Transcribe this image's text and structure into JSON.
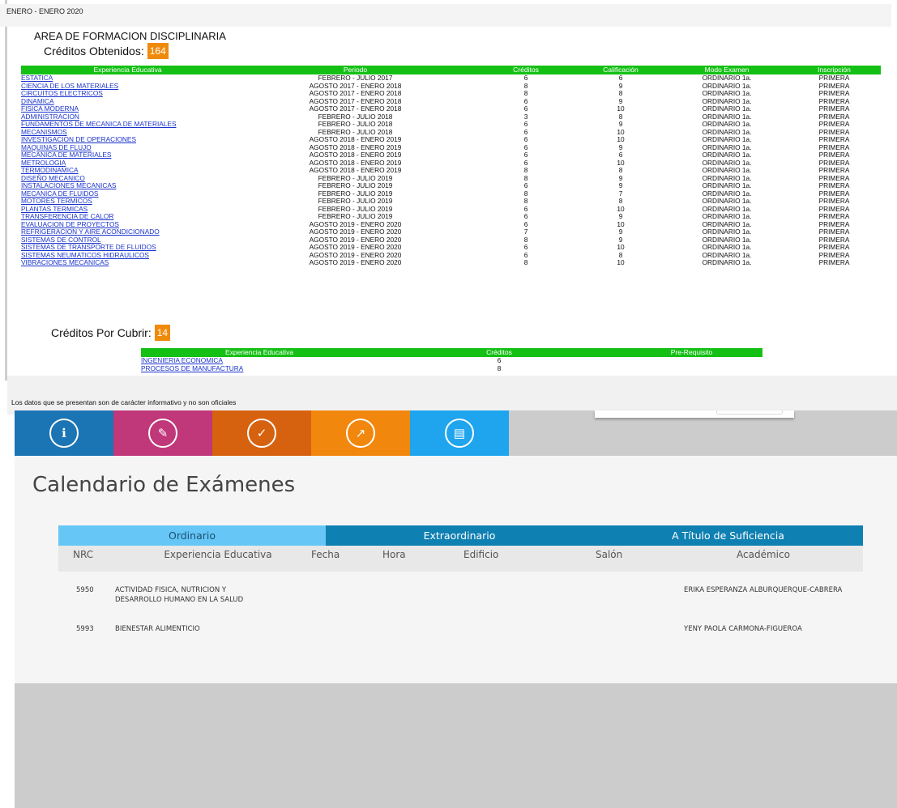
{
  "period_header": "ENERO - ENERO 2020",
  "area_title": "AREA DE FORMACION DISCIPLINARIA",
  "credits_obtained": {
    "label": "Créditos Obtenidos:",
    "value": "164"
  },
  "credits_pending": {
    "label": "Créditos Por Cubrir:",
    "value": "14"
  },
  "records_table": {
    "headers": [
      "Experiencia Educativa",
      "Periodo",
      "Créditos",
      "Calificación",
      "Modo Examen",
      "Inscripción"
    ],
    "rows": [
      [
        "ESTATICA",
        "FEBRERO - JULIO 2017",
        "6",
        "6",
        "ORDINARIO 1a.",
        "PRIMERA"
      ],
      [
        "CIENCIA DE LOS MATERIALES",
        "AGOSTO 2017 - ENERO 2018",
        "8",
        "9",
        "ORDINARIO 1a.",
        "PRIMERA"
      ],
      [
        "CIRCUITOS ELECTRICOS",
        "AGOSTO 2017 - ENERO 2018",
        "8",
        "8",
        "ORDINARIO 1a.",
        "PRIMERA"
      ],
      [
        "DINAMICA",
        "AGOSTO 2017 - ENERO 2018",
        "6",
        "9",
        "ORDINARIO 1a.",
        "PRIMERA"
      ],
      [
        "FISICA MODERNA",
        "AGOSTO 2017 - ENERO 2018",
        "6",
        "10",
        "ORDINARIO 1a.",
        "PRIMERA"
      ],
      [
        "ADMINISTRACION",
        "FEBRERO - JULIO 2018",
        "3",
        "8",
        "ORDINARIO 1a.",
        "PRIMERA"
      ],
      [
        "FUNDAMENTOS DE MECANICA DE MATERIALES",
        "FEBRERO - JULIO 2018",
        "6",
        "9",
        "ORDINARIO 1a.",
        "PRIMERA"
      ],
      [
        "MECANISMOS",
        "FEBRERO - JULIO 2018",
        "6",
        "10",
        "ORDINARIO 1a.",
        "PRIMERA"
      ],
      [
        "INVESTIGACION DE OPERACIONES",
        "AGOSTO 2018 - ENERO 2019",
        "6",
        "10",
        "ORDINARIO 1a.",
        "PRIMERA"
      ],
      [
        "MAQUINAS DE FLUJO",
        "AGOSTO 2018 - ENERO 2019",
        "6",
        "9",
        "ORDINARIO 1a.",
        "PRIMERA"
      ],
      [
        "MECANICA DE MATERIALES",
        "AGOSTO 2018 - ENERO 2019",
        "6",
        "6",
        "ORDINARIO 1a.",
        "PRIMERA"
      ],
      [
        "METROLOGIA",
        "AGOSTO 2018 - ENERO 2019",
        "6",
        "10",
        "ORDINARIO 1a.",
        "PRIMERA"
      ],
      [
        "TERMODINAMICA",
        "AGOSTO 2018 - ENERO 2019",
        "8",
        "8",
        "ORDINARIO 1a.",
        "PRIMERA"
      ],
      [
        "DISEÑO MECANICO",
        "FEBRERO - JULIO 2019",
        "8",
        "9",
        "ORDINARIO 1a.",
        "PRIMERA"
      ],
      [
        "INSTALACIONES MECANICAS",
        "FEBRERO - JULIO 2019",
        "6",
        "9",
        "ORDINARIO 1a.",
        "PRIMERA"
      ],
      [
        "MECANICA DE FLUIDOS",
        "FEBRERO - JULIO 2019",
        "8",
        "7",
        "ORDINARIO 1a.",
        "PRIMERA"
      ],
      [
        "MOTORES TERMICOS",
        "FEBRERO - JULIO 2019",
        "8",
        "8",
        "ORDINARIO 1a.",
        "PRIMERA"
      ],
      [
        "PLANTAS TERMICAS",
        "FEBRERO - JULIO 2019",
        "6",
        "10",
        "ORDINARIO 1a.",
        "PRIMERA"
      ],
      [
        "TRANSFERENCIA DE CALOR",
        "FEBRERO - JULIO 2019",
        "6",
        "9",
        "ORDINARIO 1a.",
        "PRIMERA"
      ],
      [
        "EVALUACION DE PROYECTOS",
        "AGOSTO 2019 - ENERO 2020",
        "6",
        "10",
        "ORDINARIO 1a.",
        "PRIMERA"
      ],
      [
        "REFRIGERACION Y AIRE ACONDICIONADO",
        "AGOSTO 2019 - ENERO 2020",
        "7",
        "9",
        "ORDINARIO 1a.",
        "PRIMERA"
      ],
      [
        "SISTEMAS DE CONTROL",
        "AGOSTO 2019 - ENERO 2020",
        "8",
        "9",
        "ORDINARIO 1a.",
        "PRIMERA"
      ],
      [
        "SISTEMAS DE TRANSPORTE DE FLUIDOS",
        "AGOSTO 2019 - ENERO 2020",
        "6",
        "10",
        "ORDINARIO 1a.",
        "PRIMERA"
      ],
      [
        "SISTEMAS NEUMATICOS HIDRAULICOS",
        "AGOSTO 2019 - ENERO 2020",
        "6",
        "8",
        "ORDINARIO 1a.",
        "PRIMERA"
      ],
      [
        "VIBRACIONES MECANICAS",
        "AGOSTO 2019 - ENERO 2020",
        "8",
        "10",
        "ORDINARIO 1a.",
        "PRIMERA"
      ]
    ]
  },
  "pending_table": {
    "headers": [
      "Experiencia Educativa",
      "Créditos",
      "Pre-Requisito"
    ],
    "rows": [
      [
        "INGENIERIA ECONOMICA",
        "6",
        ""
      ],
      [
        "PROCESOS DE MANUFACTURA",
        "8",
        ""
      ]
    ]
  },
  "disclaimer": "Los datos que se presentan son de carácter informativo y no son oficiales",
  "nav_tiles": [
    {
      "icon": "student-info-icon",
      "glyph": "ℹ",
      "color": "#1b75b4"
    },
    {
      "icon": "schedule-edit-icon",
      "glyph": "✎",
      "color": "#c0377a"
    },
    {
      "icon": "checklist-icon",
      "glyph": "✓",
      "color": "#d6620f"
    },
    {
      "icon": "growth-chart-icon",
      "glyph": "↗",
      "color": "#f2870d"
    },
    {
      "icon": "exam-building-icon",
      "glyph": "▤",
      "color": "#1ea5ee"
    }
  ],
  "calendar": {
    "title": "Calendario de Exámenes",
    "tabs": [
      "Ordinario",
      "Extraordinario",
      "A Título de Suficiencia"
    ],
    "columns": [
      "NRC",
      "Experiencia Educativa",
      "Fecha",
      "Hora",
      "Edificio",
      "Salón",
      "Académico"
    ],
    "rows": [
      {
        "nrc": "5950",
        "ee": "ACTIVIDAD FISICA, NUTRICION Y DESARROLLO HUMANO EN LA SALUD",
        "fecha": "",
        "hora": "",
        "edificio": "",
        "salon": "",
        "academico": "ERIKA ESPERANZA ALBURQUERQUE-CABRERA"
      },
      {
        "nrc": "5993",
        "ee": "BIENESTAR ALIMENTICIO",
        "fecha": "",
        "hora": "",
        "edificio": "",
        "salon": "",
        "academico": "YENY PAOLA CARMONA-FIGUEROA"
      }
    ]
  },
  "colors": {
    "table_header": "#15c015",
    "badge": "#f08a0a",
    "tab_active": "#66c7f7",
    "tab_inactive": "#0f80b2",
    "link": "#1a33cc"
  }
}
